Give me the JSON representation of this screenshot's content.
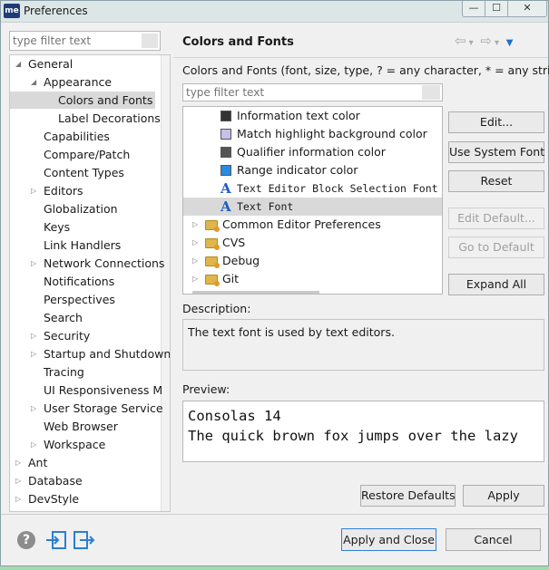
{
  "window": {
    "title": "Preferences",
    "app_icon_text": "me",
    "min_glyph": "—",
    "max_glyph": "☐",
    "close_glyph": "✕"
  },
  "sidebar": {
    "filter_placeholder": "type filter text",
    "items": [
      {
        "label": "General",
        "indent": 0,
        "expanded": true
      },
      {
        "label": "Appearance",
        "indent": 1,
        "expanded": true
      },
      {
        "label": "Colors and Fonts",
        "indent": 2,
        "selected": true
      },
      {
        "label": "Label Decorations",
        "indent": 2
      },
      {
        "label": "Capabilities",
        "indent": 1
      },
      {
        "label": "Compare/Patch",
        "indent": 1
      },
      {
        "label": "Content Types",
        "indent": 1
      },
      {
        "label": "Editors",
        "indent": 1,
        "collapsed": true
      },
      {
        "label": "Globalization",
        "indent": 1
      },
      {
        "label": "Keys",
        "indent": 1
      },
      {
        "label": "Link Handlers",
        "indent": 1
      },
      {
        "label": "Network Connections",
        "indent": 1,
        "collapsed": true
      },
      {
        "label": "Notifications",
        "indent": 1
      },
      {
        "label": "Perspectives",
        "indent": 1
      },
      {
        "label": "Search",
        "indent": 1
      },
      {
        "label": "Security",
        "indent": 1,
        "collapsed": true
      },
      {
        "label": "Startup and Shutdown",
        "indent": 1,
        "collapsed": true
      },
      {
        "label": "Tracing",
        "indent": 1
      },
      {
        "label": "UI Responsiveness M",
        "indent": 1
      },
      {
        "label": "User Storage Service",
        "indent": 1,
        "collapsed": true
      },
      {
        "label": "Web Browser",
        "indent": 1
      },
      {
        "label": "Workspace",
        "indent": 1,
        "collapsed": true
      },
      {
        "label": "Ant",
        "indent": 0,
        "collapsed": true
      },
      {
        "label": "Database",
        "indent": 0,
        "collapsed": true
      },
      {
        "label": "DevStyle",
        "indent": 0,
        "collapsed": true
      }
    ]
  },
  "main": {
    "title": "Colors and Fonts",
    "nav": {
      "back": "⇦",
      "forward": "⇨",
      "dropdown": "▾",
      "menu": "▼"
    },
    "intro": "Colors and Fonts (font, size, type, ? = any character, * = any string) :",
    "filter_placeholder": "type filter text",
    "tree_items": [
      {
        "label": "Information text color",
        "kind": "color",
        "color": "#333333"
      },
      {
        "label": "Match highlight background color",
        "kind": "color",
        "color": "#c8c0e8"
      },
      {
        "label": "Qualifier information color",
        "kind": "color",
        "color": "#555555"
      },
      {
        "label": "Range indicator color",
        "kind": "color",
        "color": "#2a8adf"
      },
      {
        "label": "Text Editor Block Selection Font",
        "kind": "font"
      },
      {
        "label": "Text Font",
        "kind": "font",
        "selected": true
      },
      {
        "label": "Common Editor Preferences",
        "kind": "folder"
      },
      {
        "label": "CVS",
        "kind": "folder"
      },
      {
        "label": "Debug",
        "kind": "folder"
      },
      {
        "label": "Git",
        "kind": "folder"
      }
    ],
    "buttons": {
      "edit": "Edit...",
      "use_system_font": "Use System Font",
      "reset": "Reset",
      "edit_default": "Edit Default...",
      "go_to_default": "Go to Default",
      "expand_all": "Expand All"
    },
    "description_label": "Description:",
    "description_text": "The text font is used by text editors.",
    "preview_label": "Preview:",
    "preview_line1": "Consolas 14",
    "preview_line2": "The quick brown fox jumps over the lazy",
    "restore_defaults": "Restore Defaults",
    "apply": "Apply"
  },
  "footer": {
    "help_glyph": "?",
    "apply_and_close": "Apply and Close",
    "cancel": "Cancel"
  }
}
